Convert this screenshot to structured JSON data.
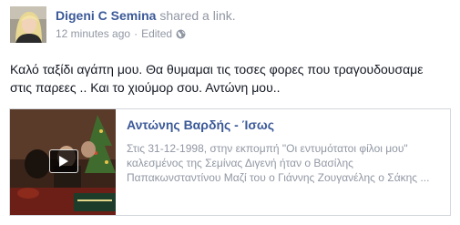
{
  "post": {
    "author": "Digeni C Semina",
    "action": "shared a link.",
    "timestamp": "12 minutes ago",
    "separator": "·",
    "edited": "Edited",
    "privacy_icon": "globe-icon",
    "message_lines": [
      "Καλό ταξίδι αγάπη μου. Θα θυμαμαι τις τοσες φορες που τραγουδουσαμε",
      "στις παρεες .. Και το χιούμορ σου. Αντώνη μου.."
    ]
  },
  "link": {
    "title": "Αντώνης Βαρδής - Ίσως",
    "description_lines": [
      "Στις 31-12-1998, στην εκπομπή \"Οι εντυμότατοι φίλοι μου\"",
      "καλεσμένος της Σεμίνας Διγενή ήταν ο Βασίλης",
      "Παπακωνσταντίνου Μαζί του ο Γιάννης Ζουγανέλης ο Σάκης ..."
    ],
    "thumbnail_icon": "play-icon"
  },
  "colors": {
    "link_blue": "#3b5998",
    "meta_grey": "#9197a3",
    "text": "#141823",
    "border": "#d3d6db"
  }
}
